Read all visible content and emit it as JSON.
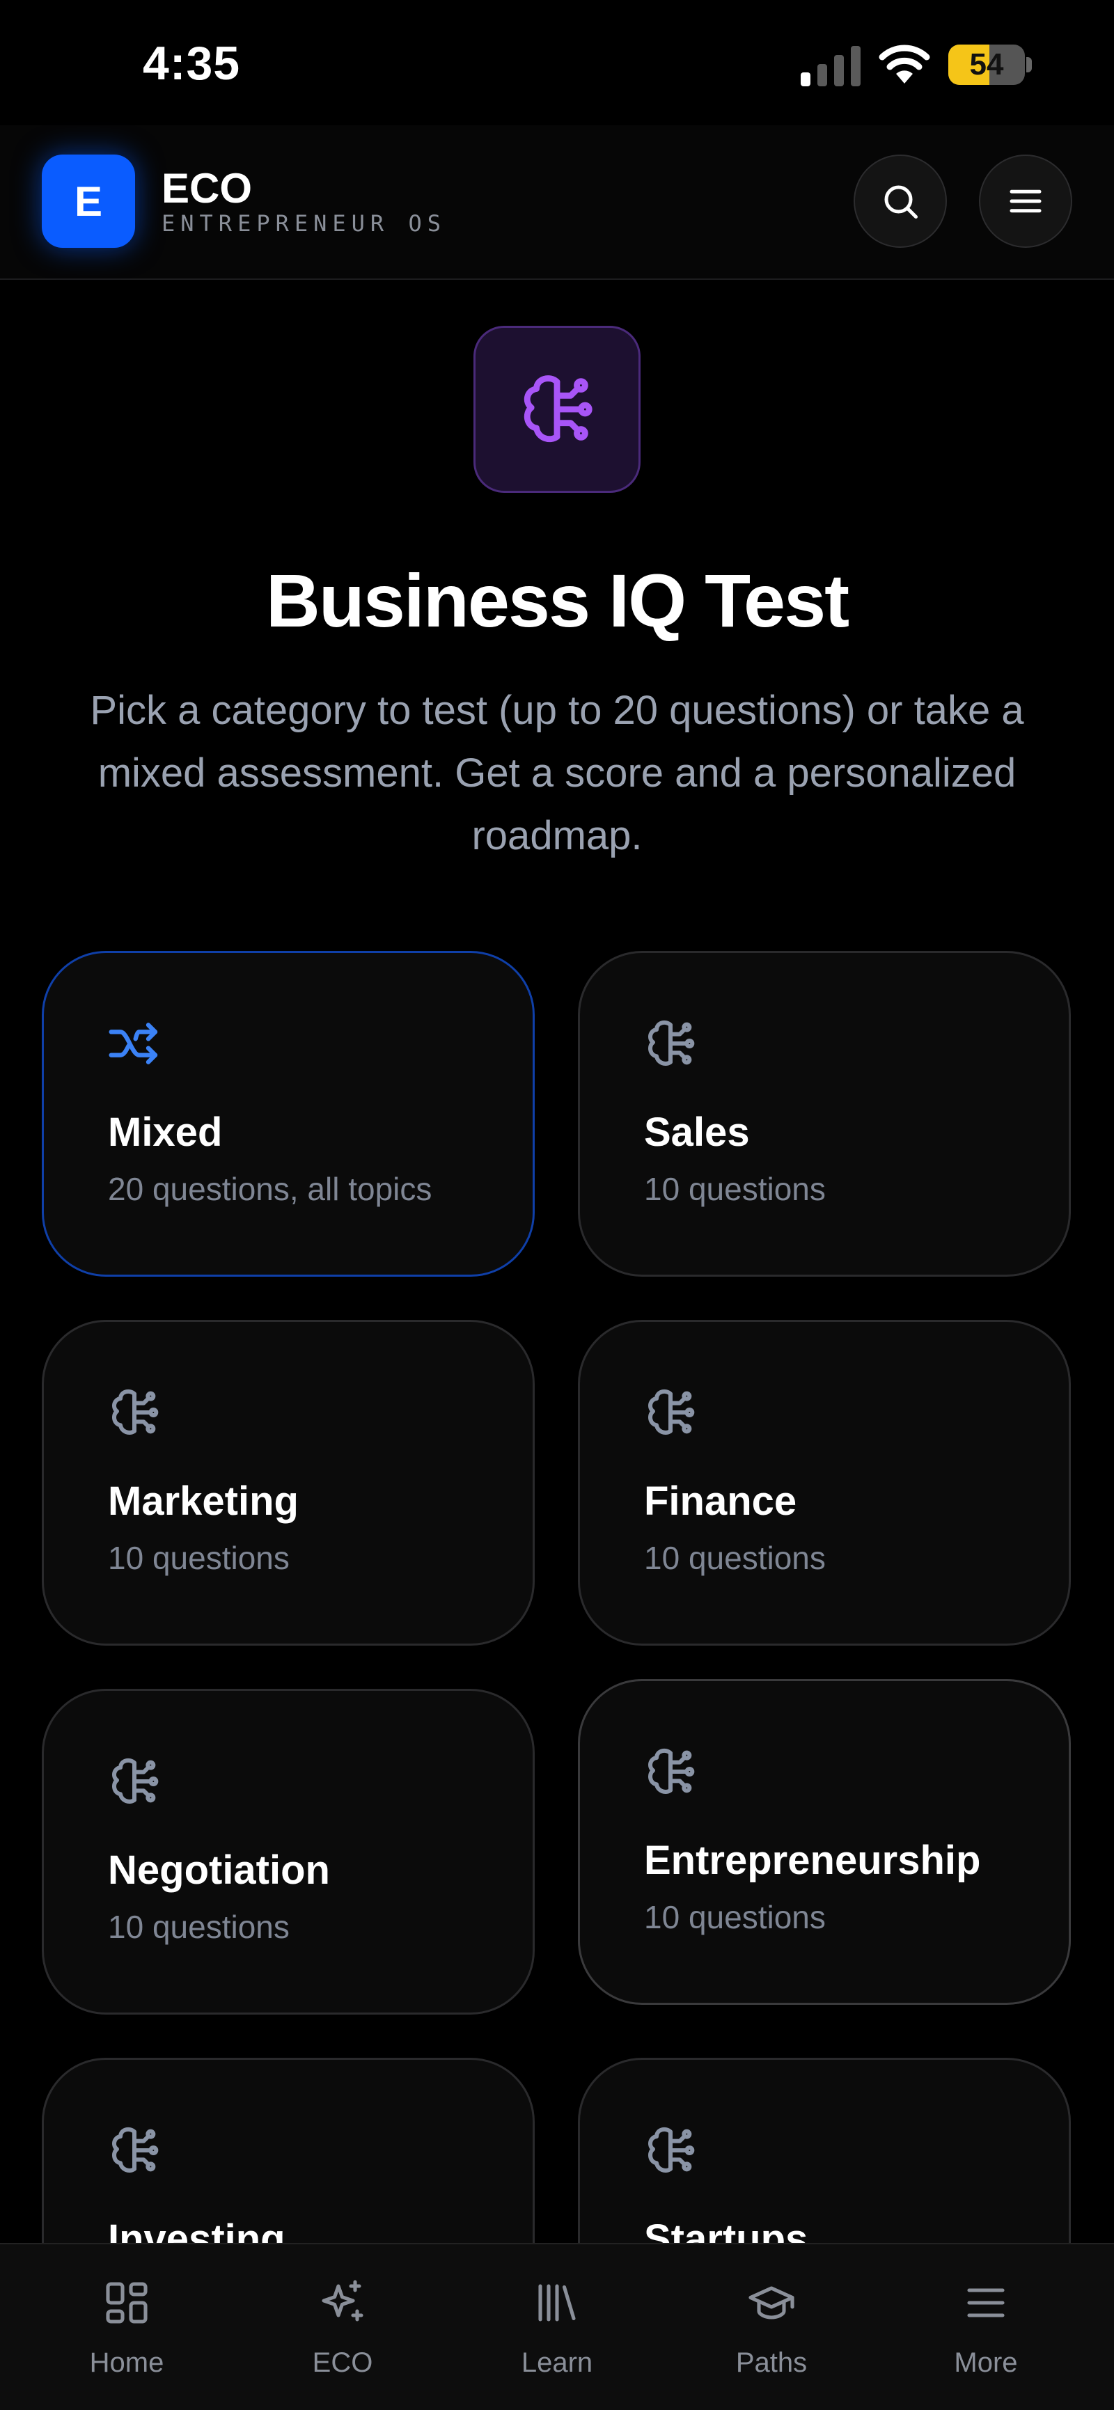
{
  "status_bar": {
    "time": "4:35",
    "battery_level": "54",
    "battery_fraction": 0.54,
    "battery_color": "#f5c518"
  },
  "header": {
    "logo_letter": "E",
    "brand_name": "ECO",
    "brand_tagline": "ENTREPRENEUR OS",
    "accent_color": "#0a5cff",
    "search_icon": "search-icon",
    "menu_icon": "hamburger-menu-icon"
  },
  "hero": {
    "icon": "brain-icon",
    "title": "Business IQ Test",
    "subtitle": "Pick a category to test (up to 20 questions) or take a mixed assessment. Get a score and a personalized roadmap."
  },
  "categories": [
    {
      "title": "Mixed",
      "subtitle": "20 questions, all topics",
      "icon": "shuffle-icon",
      "selected": true
    },
    {
      "title": "Sales",
      "subtitle": "10 questions",
      "icon": "brain-icon"
    },
    {
      "title": "Marketing",
      "subtitle": "10 questions",
      "icon": "brain-icon"
    },
    {
      "title": "Finance",
      "subtitle": "10 questions",
      "icon": "brain-icon"
    },
    {
      "title": "Negotiation",
      "subtitle": "10 questions",
      "icon": "brain-icon"
    },
    {
      "title": "Entrepreneurship",
      "subtitle": "10 questions",
      "icon": "brain-icon"
    },
    {
      "title": "Investing",
      "icon": "brain-icon"
    },
    {
      "title": "Startups",
      "icon": "brain-icon"
    }
  ],
  "bottom_nav": [
    {
      "label": "Home",
      "icon": "grid-icon"
    },
    {
      "label": "ECO",
      "icon": "sparkle-icon"
    },
    {
      "label": "Learn",
      "icon": "library-icon"
    },
    {
      "label": "Paths",
      "icon": "graduation-cap-icon"
    },
    {
      "label": "More",
      "icon": "hamburger-menu-icon"
    }
  ]
}
